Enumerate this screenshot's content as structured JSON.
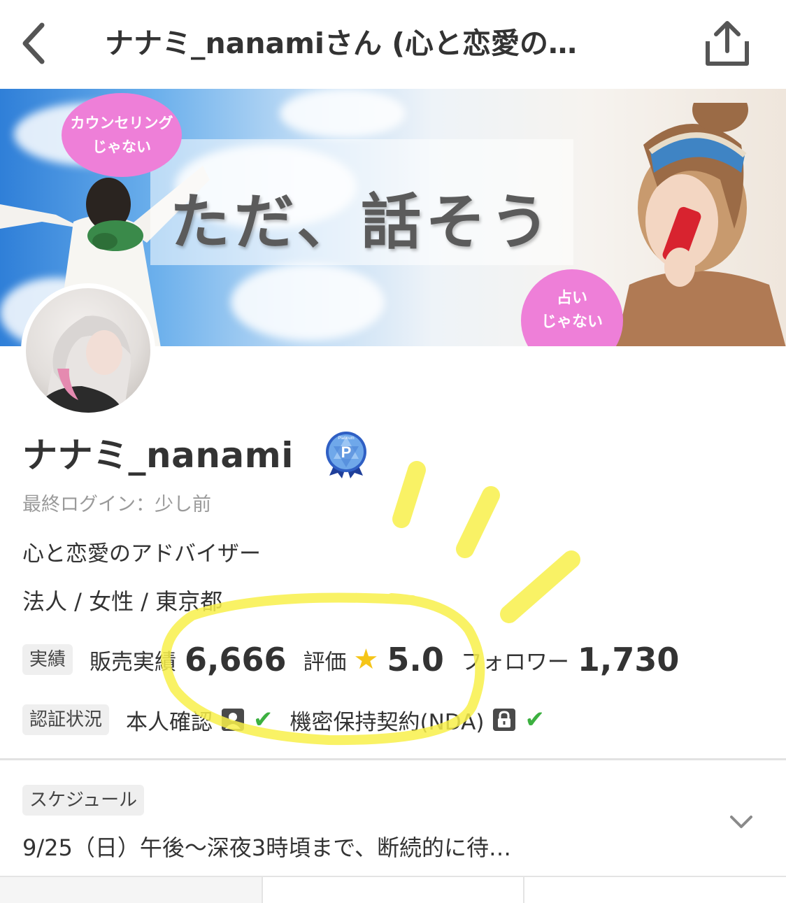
{
  "header": {
    "title": "ナナミ_nanamiさん (心と恋愛の…",
    "back_icon": "chevron-left-icon",
    "share_icon": "share-icon"
  },
  "banner": {
    "headline": "ただ、話そう",
    "bubble_left_line1": "カウンセリング",
    "bubble_left_line2": "じゃない",
    "bubble_right_line1": "占い",
    "bubble_right_line2": "じゃない",
    "bubble_color": "#ee7fd8"
  },
  "profile": {
    "name": "ナナミ_nanami",
    "badge": "Platinum",
    "badge_letter": "P",
    "last_login": "最終ログイン：少し前",
    "tagline": "心と恋愛のアドバイザー",
    "meta": "法人 / 女性 / 東京都"
  },
  "stats": {
    "chip": "実績",
    "sales_label": "販売実績",
    "sales_value": "6,666",
    "rating_label": "評価",
    "rating_value": "5.0",
    "followers_label": "フォロワー",
    "followers_value": "1,730"
  },
  "verification": {
    "chip": "認証状況",
    "identity_label": "本人確認",
    "nda_label": "機密保持契約(NDA)",
    "check_color": "#3cb040"
  },
  "schedule": {
    "chip": "スケジュール",
    "text": "9/25（日）午後〜深夜3時頃まで、断続的に待…"
  },
  "colors": {
    "highlighter": "#f8f04a",
    "star": "#f5c518"
  }
}
